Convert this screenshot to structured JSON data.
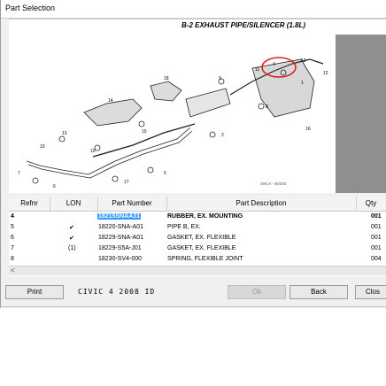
{
  "window": {
    "title": "Part Selection"
  },
  "diagram": {
    "title": "B-2 EXHAUST PIPE/SILENCER (1.8L)",
    "code": "SNCA - B0200",
    "callouts": [
      "1",
      "2",
      "3",
      "4",
      "5",
      "6",
      "7",
      "8",
      "9",
      "10",
      "11",
      "12",
      "13",
      "14",
      "15",
      "16",
      "17",
      "18",
      "19"
    ],
    "highlight_color": "#e02020"
  },
  "grid": {
    "headers": {
      "refnr": "Refnr",
      "lon": "LON",
      "part_number": "Part Number",
      "description": "Part Description",
      "qty": "Qty"
    },
    "rows": [
      {
        "refnr": "4",
        "lon": "",
        "part_number": "18215SNAA31",
        "description": "RUBBER, EX. MOUNTING",
        "qty": "001"
      },
      {
        "refnr": "5",
        "lon": "✔",
        "part_number": "18220-SNA-A01",
        "description": "PIPE B, EX.",
        "qty": "001"
      },
      {
        "refnr": "6",
        "lon": "✔",
        "part_number": "18229-SNA-A01",
        "description": "GASKET, EX. FLEXIBLE",
        "qty": "001"
      },
      {
        "refnr": "7",
        "lon": "(1)",
        "part_number": "18229-S5A-J01",
        "description": "GASKET, EX. FLEXIBLE",
        "qty": "001"
      },
      {
        "refnr": "8",
        "lon": "",
        "part_number": "18230-SV4-000",
        "description": "SPRING, FLEXIBLE JOINT",
        "qty": "004"
      }
    ],
    "scroll_left": "<"
  },
  "footer": {
    "print": "Print",
    "vehicle": "CIVIC 4 2008 ID",
    "ok": "Ok",
    "back": "Back",
    "close": "Clos"
  }
}
